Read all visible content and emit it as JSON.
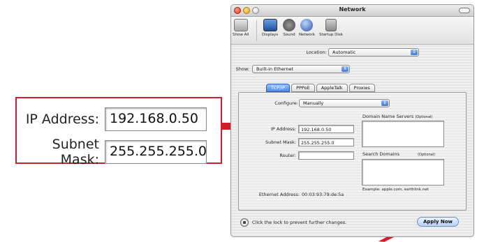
{
  "callout": {
    "ip_label": "IP Address:",
    "ip_value": "192.168.0.50",
    "mask_label": "Subnet Mask:",
    "mask_value": "255.255.255.0"
  },
  "window": {
    "title": "Network",
    "toolbar": {
      "show_all": "Show All",
      "items": [
        "Displays",
        "Sound",
        "Network",
        "Startup Disk"
      ]
    },
    "location_label": "Location:",
    "location_value": "Automatic",
    "show_label": "Show:",
    "show_value": "Built-in Ethernet",
    "tabs": [
      "TCP/IP",
      "PPPoE",
      "AppleTalk",
      "Proxies"
    ],
    "active_tab": "TCP/IP",
    "configure_label": "Configure:",
    "configure_value": "Manually",
    "dns_label": "Domain Name Servers",
    "dns_optional": "(Optional)",
    "ip_label": "IP Address:",
    "ip_value": "192.168.0.50",
    "mask_label": "Subnet Mask:",
    "mask_value": "255.255.255.0",
    "router_label": "Router:",
    "router_value": "",
    "search_domains_label": "Search Domains",
    "search_optional": "(Optional)",
    "example_text": "Example: apple.com, earthlink.net",
    "ethernet_label": "Ethernet Address:",
    "ethernet_value": "00:03:93:79:de:5a",
    "lock_text": "Click the lock to prevent further changes.",
    "apply_label": "Apply Now"
  },
  "colors": {
    "callout_border": "#cc1f2e",
    "arrow": "#d31e2a",
    "aqua_blue": "#4a88e6"
  }
}
